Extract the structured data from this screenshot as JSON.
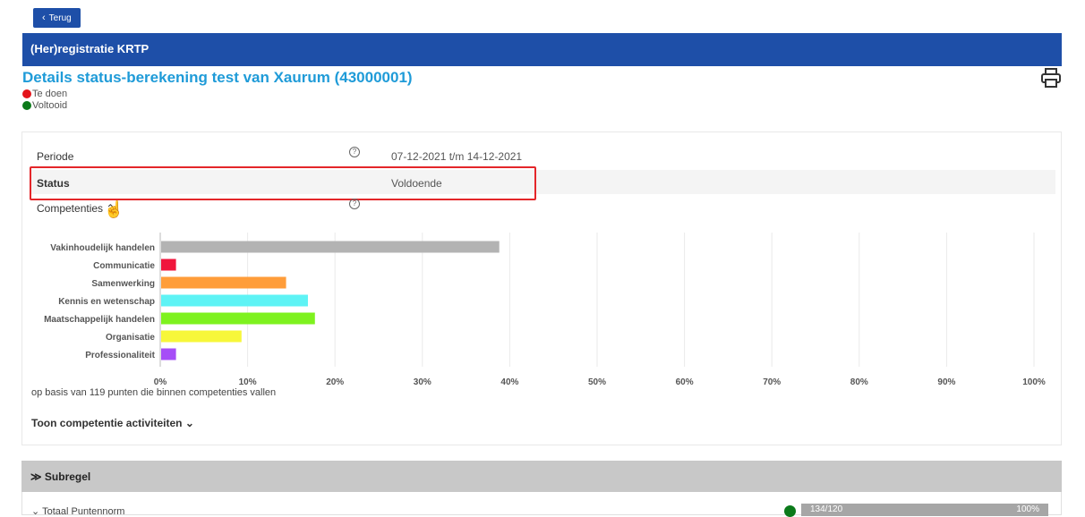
{
  "topbar": {
    "back_label": "Terug"
  },
  "header": {
    "title": "(Her)registratie KRTP"
  },
  "page": {
    "title": "Details status-berekening test van Xaurum (43000001)"
  },
  "legend": [
    {
      "label": "Te doen",
      "color": "#e4141b"
    },
    {
      "label": "Voltooid",
      "color": "#0b7a1a"
    }
  ],
  "details": {
    "periode_label": "Periode",
    "periode_help": "?",
    "periode_value": "07-12-2021 t/m 14-12-2021",
    "status_label": "Status",
    "status_value": "Voldoende",
    "competenties_label": "Competenties",
    "competenties_help": "?"
  },
  "chart_data": {
    "type": "bar",
    "orientation": "horizontal",
    "categories": [
      "Vakinhoudelijk handelen",
      "Communicatie",
      "Samenwerking",
      "Kennis en wetenschap",
      "Maatschappelijk handelen",
      "Organisatie",
      "Professionaliteit"
    ],
    "values": [
      38.7,
      1.7,
      14.3,
      16.8,
      17.6,
      9.2,
      1.7
    ],
    "colors": [
      "#b3b3b3",
      "#f0163c",
      "#ff9d3a",
      "#5ef3f5",
      "#7ef21f",
      "#f7f73a",
      "#a64df7"
    ],
    "x_ticks": [
      "0%",
      "10%",
      "20%",
      "30%",
      "40%",
      "50%",
      "60%",
      "70%",
      "80%",
      "90%",
      "100%"
    ],
    "xlim": [
      0,
      100
    ],
    "grid": true
  },
  "footnote": "op basis van 119 punten die binnen competenties vallen",
  "toggle_activities": "Toon competentie activiteiten",
  "subregel": {
    "title": "Subregel",
    "total_label": "Totaal Puntennorm",
    "progress_text": "134/120",
    "progress_percent": "100%",
    "progress_fraction": 1.0,
    "status_color": "#0b7a1a"
  }
}
